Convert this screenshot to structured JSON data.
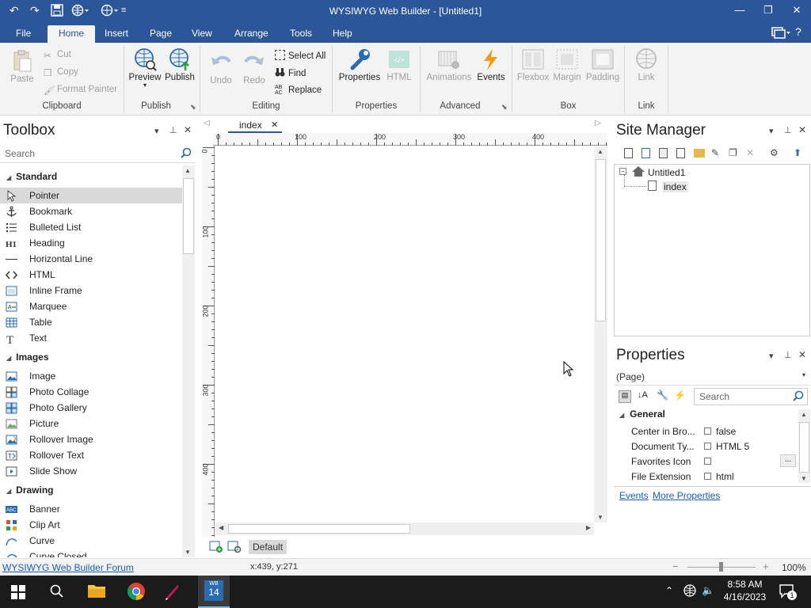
{
  "window": {
    "title": "WYSIWYG Web Builder - [Untitled1]"
  },
  "menu": [
    "File",
    "Home",
    "Insert",
    "Page",
    "View",
    "Arrange",
    "Tools",
    "Help"
  ],
  "menu_active": "Home",
  "ribbon": {
    "clipboard": {
      "paste": "Paste",
      "cut": "Cut",
      "copy": "Copy",
      "format_painter": "Format Painter",
      "label": "Clipboard"
    },
    "publish": {
      "preview": "Preview",
      "publish": "Publish",
      "label": "Publish"
    },
    "editing": {
      "undo": "Undo",
      "redo": "Redo",
      "select_all": "Select All",
      "find": "Find",
      "replace": "Replace",
      "label": "Editing"
    },
    "properties": {
      "properties": "Properties",
      "html": "HTML",
      "label": "Properties"
    },
    "advanced": {
      "animations": "Animations",
      "events": "Events",
      "label": "Advanced"
    },
    "box": {
      "flexbox": "Flexbox",
      "margin": "Margin",
      "padding": "Padding",
      "label": "Box"
    },
    "link": {
      "link": "Link",
      "label": "Link"
    }
  },
  "toolbox": {
    "title": "Toolbox",
    "search_placeholder": "Search",
    "categories": [
      {
        "name": "Standard",
        "items": [
          {
            "label": "Pointer",
            "icon": "pointer-icon"
          },
          {
            "label": "Bookmark",
            "icon": "anchor-icon"
          },
          {
            "label": "Bulleted List",
            "icon": "list-icon"
          },
          {
            "label": "Heading",
            "icon": "heading-icon"
          },
          {
            "label": "Horizontal Line",
            "icon": "hline-icon"
          },
          {
            "label": "HTML",
            "icon": "code-icon"
          },
          {
            "label": "Inline Frame",
            "icon": "iframe-icon"
          },
          {
            "label": "Marquee",
            "icon": "marquee-icon"
          },
          {
            "label": "Table",
            "icon": "table-icon"
          },
          {
            "label": "Text",
            "icon": "text-icon"
          }
        ]
      },
      {
        "name": "Images",
        "items": [
          {
            "label": "Image",
            "icon": "image-icon"
          },
          {
            "label": "Photo Collage",
            "icon": "collage-icon"
          },
          {
            "label": "Photo Gallery",
            "icon": "gallery-icon"
          },
          {
            "label": "Picture",
            "icon": "picture-icon"
          },
          {
            "label": "Rollover Image",
            "icon": "rollover-image-icon"
          },
          {
            "label": "Rollover Text",
            "icon": "rollover-text-icon"
          },
          {
            "label": "Slide Show",
            "icon": "slideshow-icon"
          }
        ]
      },
      {
        "name": "Drawing",
        "items": [
          {
            "label": "Banner",
            "icon": "banner-icon"
          },
          {
            "label": "Clip Art",
            "icon": "clipart-icon"
          },
          {
            "label": "Curve",
            "icon": "curve-icon"
          },
          {
            "label": "Curve Closed",
            "icon": "curve-closed-icon"
          }
        ]
      }
    ]
  },
  "editor": {
    "tab": "index",
    "ruler_h": [
      "0",
      "100",
      "200",
      "300",
      "400"
    ],
    "ruler_v": [
      "0",
      "100",
      "200",
      "300",
      "400"
    ],
    "layout_name": "Default"
  },
  "site_manager": {
    "title": "Site Manager",
    "site": "Untitled1",
    "page": "index"
  },
  "properties": {
    "title": "Properties",
    "object": "(Page)",
    "search_placeholder": "Search",
    "group": "General",
    "rows": [
      {
        "name": "Center in Bro...",
        "value": "false"
      },
      {
        "name": "Document Ty...",
        "value": "HTML 5"
      },
      {
        "name": "Favorites Icon",
        "value": ""
      },
      {
        "name": "File Extension",
        "value": "html"
      }
    ],
    "ellipsis": "...",
    "events_link": "Events",
    "more_link": "More Properties"
  },
  "status": {
    "forum_link": "WYSIWYG Web Builder Forum",
    "coords": "x:439, y:271",
    "zoom": "100%"
  },
  "taskbar": {
    "time": "8:58 AM",
    "date": "4/16/2023",
    "notif_count": "1",
    "wb_label": "14"
  }
}
